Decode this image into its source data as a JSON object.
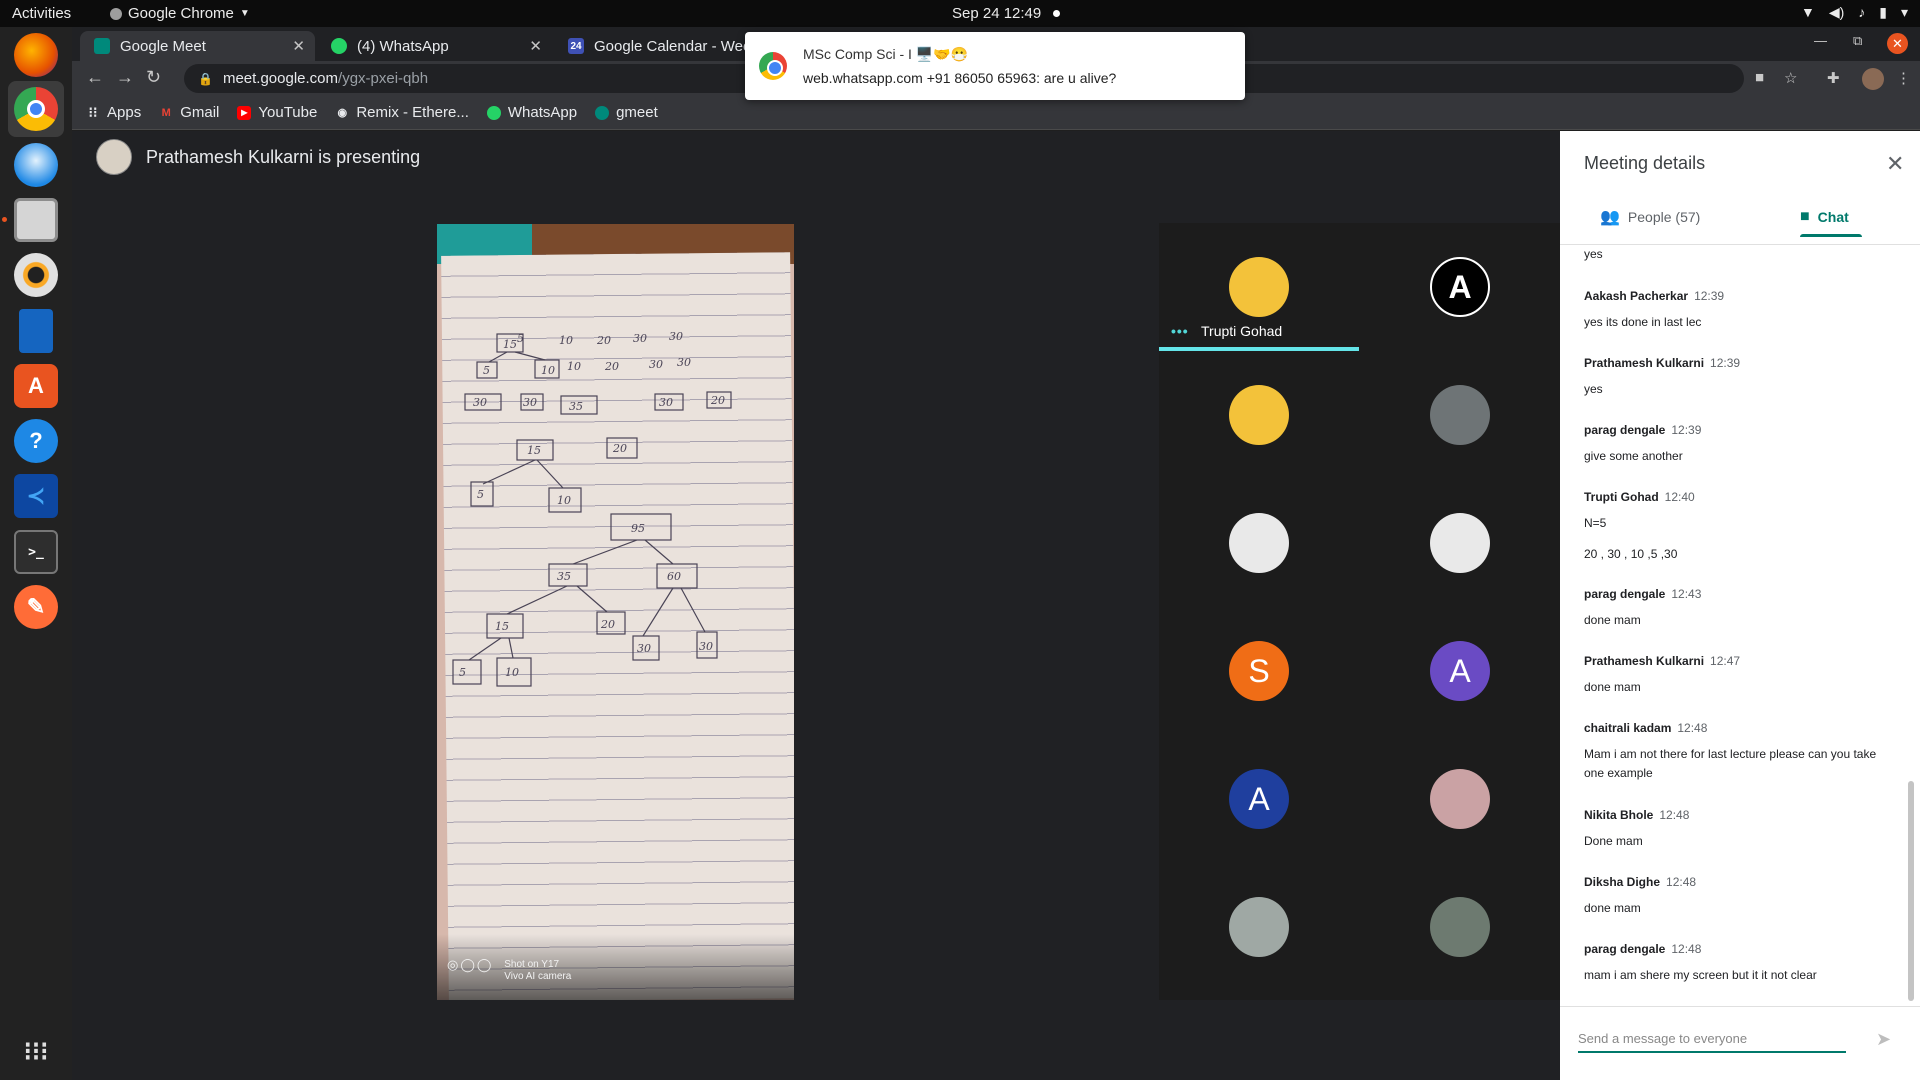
{
  "topbar": {
    "activities": "Activities",
    "app_name": "Google Chrome",
    "clock": "Sep 24  12:49"
  },
  "browser": {
    "tabs": [
      {
        "label": "Google Meet",
        "favicon_color": "#00897b"
      },
      {
        "label": "(4) WhatsApp",
        "favicon_color": "#25d366"
      },
      {
        "label": "Google Calendar - Wee",
        "favicon_color": "#3f51b5",
        "favicon_text": "24"
      }
    ],
    "url_host": "meet.google.com",
    "url_path": "/ygx-pxei-qbh",
    "bookmarks": [
      {
        "label": "Apps",
        "icon": "apps-grid-icon"
      },
      {
        "label": "Gmail",
        "icon": "gmail-icon"
      },
      {
        "label": "YouTube",
        "icon": "youtube-icon"
      },
      {
        "label": "Remix - Ethere...",
        "icon": "remix-icon"
      },
      {
        "label": "WhatsApp",
        "icon": "whatsapp-icon"
      },
      {
        "label": "gmeet",
        "icon": "gmeet-icon"
      }
    ]
  },
  "notification": {
    "title": "MSc Comp Sci - I 🖥️🤝😷",
    "body": "web.whatsapp.com  +91 86050 65963: are u alive?"
  },
  "meet": {
    "presenting_text": "Prathamesh Kulkarni is presenting",
    "watermark_line1": "Shot on Y17",
    "watermark_line2": "Vivo AI camera",
    "handwriting": {
      "row1": [
        "5",
        "10",
        "20",
        "30",
        "30"
      ],
      "row2_box": "15",
      "row2_rest": [
        "10",
        "20",
        "30",
        "30"
      ],
      "row3": [
        "5",
        "10"
      ],
      "row4": [
        "30",
        "30",
        "35",
        "30",
        "20"
      ],
      "row5": [
        "15",
        "20"
      ],
      "row6": [
        "5",
        "10"
      ],
      "root": "95",
      "row8": [
        "35",
        "60"
      ],
      "row9": [
        "15",
        "20",
        "30",
        "30"
      ],
      "row10": [
        "5",
        "10"
      ]
    },
    "participants": [
      {
        "label": "",
        "name": "Trupti Gohad",
        "color": "#f3c23a",
        "speaking": true
      },
      {
        "label": "A",
        "color": "#000000"
      },
      {
        "label": "",
        "color": "#f3c23a"
      },
      {
        "label": "",
        "color": "#6e7476"
      },
      {
        "label": "",
        "color": "#e9e9e9"
      },
      {
        "label": "",
        "color": "#e9e9e9"
      },
      {
        "label": "S",
        "color": "#f06d16"
      },
      {
        "label": "A",
        "color": "#6a4bc4"
      },
      {
        "label": "A",
        "color": "#1f3f9e"
      },
      {
        "label": "",
        "color": "#caa2a4"
      },
      {
        "label": "",
        "color": "#9fa8a4"
      },
      {
        "label": "",
        "color": "#6d7a70"
      }
    ]
  },
  "panel": {
    "title": "Meeting details",
    "tab_people": "People (57)",
    "tab_chat": "Chat",
    "composer_placeholder": "Send a message to everyone",
    "messages": [
      {
        "sender": "",
        "time": "",
        "text": "yes"
      },
      {
        "sender": "Aakash Pacherkar",
        "time": "12:39",
        "text": "yes its done in last lec"
      },
      {
        "sender": "Prathamesh Kulkarni",
        "time": "12:39",
        "text": "yes"
      },
      {
        "sender": "parag dengale",
        "time": "12:39",
        "text": "give some another"
      },
      {
        "sender": "Trupti Gohad",
        "time": "12:40",
        "text": "N=5",
        "text2": "20 , 30 , 10 ,5 ,30"
      },
      {
        "sender": "parag dengale",
        "time": "12:43",
        "text": "done mam"
      },
      {
        "sender": "Prathamesh Kulkarni",
        "time": "12:47",
        "text": "done mam"
      },
      {
        "sender": "chaitrali kadam",
        "time": "12:48",
        "text": "Mam i am not there for last lecture please can you take one example"
      },
      {
        "sender": "Nikita Bhole",
        "time": "12:48",
        "text": "Done mam"
      },
      {
        "sender": "Diksha Dighe",
        "time": "12:48",
        "text": "done mam"
      },
      {
        "sender": "parag dengale",
        "time": "12:48",
        "text": "mam i am shere my screen but it it not clear"
      }
    ]
  },
  "colors": {
    "accent": "#00796b",
    "speaking": "#64e4e8",
    "ubuntu_orange": "#e95420"
  }
}
